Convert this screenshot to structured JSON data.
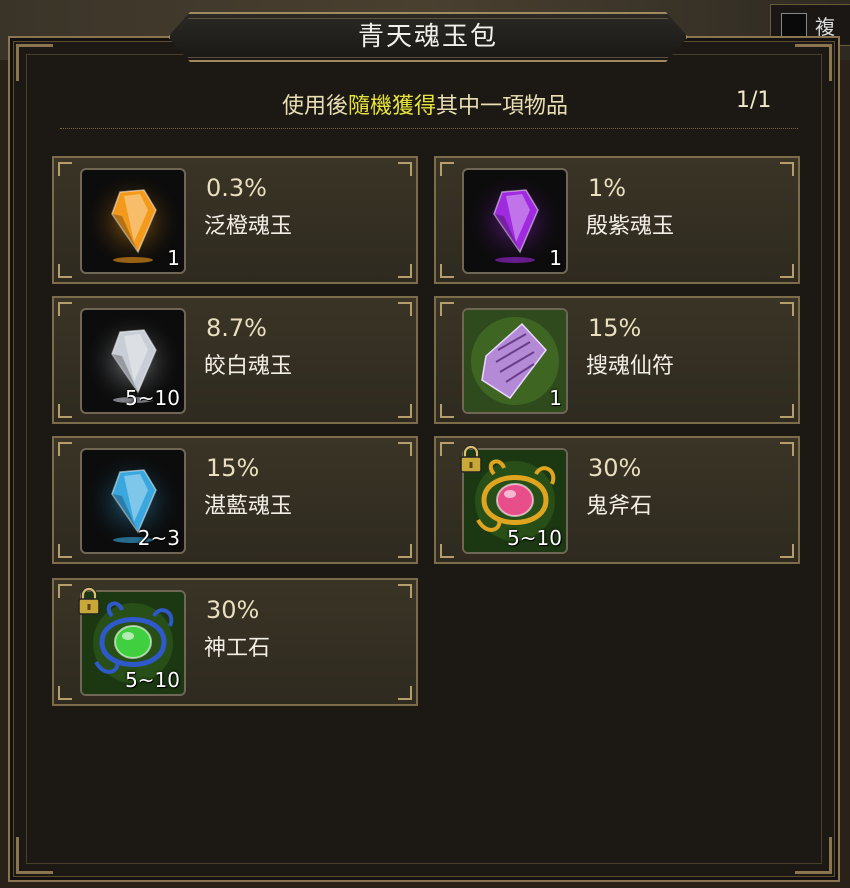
{
  "window": {
    "title": "青天魂玉包",
    "subtitle_prefix": "使用後",
    "subtitle_highlight": "隨機獲得",
    "subtitle_suffix": "其中一項物品",
    "pager": "1/1",
    "background_label": "複"
  },
  "colors": {
    "highlight": "#e6e33a",
    "frame": "#8a7550",
    "text": "#f3efe6"
  },
  "items": [
    {
      "name": "泛橙魂玉",
      "chance": "0.3%",
      "qty": "1",
      "icon": "orange-gem-icon",
      "color": "#f39a1c",
      "locked": false
    },
    {
      "name": "殷紫魂玉",
      "chance": "1%",
      "qty": "1",
      "icon": "purple-gem-icon",
      "color": "#a02adf",
      "locked": false
    },
    {
      "name": "皎白魂玉",
      "chance": "8.7%",
      "qty": "5~10",
      "icon": "white-gem-icon",
      "color": "#c9ced6",
      "locked": false
    },
    {
      "name": "搜魂仙符",
      "chance": "15%",
      "qty": "1",
      "icon": "talisman-scroll-icon",
      "color": "#b48ad6",
      "locked": false
    },
    {
      "name": "湛藍魂玉",
      "chance": "15%",
      "qty": "2~3",
      "icon": "blue-gem-icon",
      "color": "#3aa8df",
      "locked": false
    },
    {
      "name": "鬼斧石",
      "chance": "30%",
      "qty": "5~10",
      "icon": "red-amulet-stone-icon",
      "color": "#e84f8a",
      "locked": true
    },
    {
      "name": "神工石",
      "chance": "30%",
      "qty": "5~10",
      "icon": "green-amulet-stone-icon",
      "color": "#3fcf3f",
      "locked": true
    }
  ]
}
